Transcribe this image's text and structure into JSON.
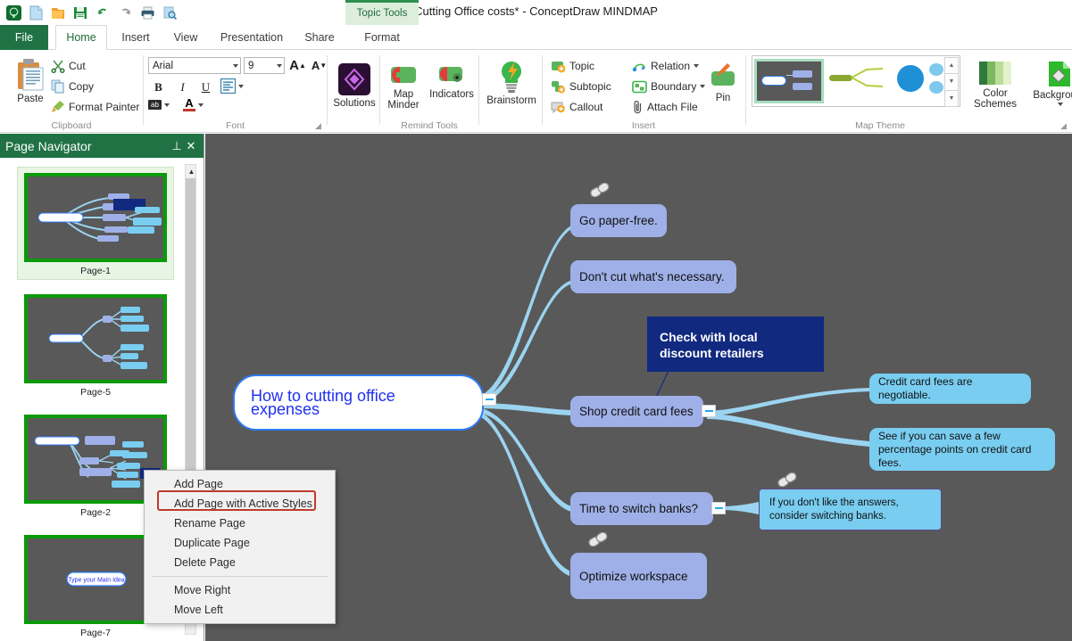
{
  "window": {
    "title": "Cutting Office costs* - ConceptDraw MINDMAP",
    "contextual_tools": "Topic Tools",
    "contextual_tab": "Format"
  },
  "quick_access": [
    {
      "name": "app-logo-icon",
      "glyph": "CD"
    },
    {
      "name": "new-document-icon",
      "glyph": "new"
    },
    {
      "name": "open-folder-icon",
      "glyph": "open"
    },
    {
      "name": "save-icon",
      "glyph": "save"
    },
    {
      "name": "undo-icon",
      "glyph": "undo"
    },
    {
      "name": "redo-icon",
      "glyph": "redo"
    },
    {
      "name": "print-icon",
      "glyph": "print"
    },
    {
      "name": "print-preview-icon",
      "glyph": "preview"
    }
  ],
  "tabs": [
    {
      "label": "File",
      "active": false
    },
    {
      "label": "Home",
      "active": true
    },
    {
      "label": "Insert",
      "active": false
    },
    {
      "label": "View",
      "active": false
    },
    {
      "label": "Presentation",
      "active": false
    },
    {
      "label": "Share",
      "active": false
    },
    {
      "label": "Format",
      "active": false
    }
  ],
  "ribbon": {
    "clipboard": {
      "title": "Clipboard",
      "paste": "Paste",
      "cut": "Cut",
      "copy": "Copy",
      "format_painter": "Format Painter"
    },
    "font": {
      "title": "Font",
      "family": "Arial",
      "size": "9",
      "grow_label": "A",
      "shrink_label": "A",
      "bold": "B",
      "italic": "I",
      "underline": "U",
      "highlight": "ab",
      "font_color": "A"
    },
    "solutions": {
      "label": "Solutions"
    },
    "remind_tools": {
      "title": "Remind Tools",
      "map_minder": "Map Minder",
      "indicators": "Indicators"
    },
    "brainstorm": {
      "label": "Brainstorm"
    },
    "insert": {
      "title": "Insert",
      "topic": "Topic",
      "subtopic": "Subtopic",
      "callout": "Callout",
      "relation": "Relation",
      "boundary": "Boundary",
      "attach_file": "Attach File",
      "pin": "Pin"
    },
    "map_theme": {
      "title": "Map Theme",
      "color_schemes": "Color Schemes",
      "background": "Background",
      "themes": [
        {
          "name": "theme-dark-selected",
          "selected": true
        },
        {
          "name": "theme-olive",
          "selected": false
        },
        {
          "name": "theme-blue-circle",
          "selected": false
        }
      ]
    }
  },
  "page_navigator": {
    "title": "Page Navigator",
    "pin_icon": "pin-icon",
    "close_icon": "close-icon",
    "pages": [
      {
        "label": "Page-1",
        "selected": true
      },
      {
        "label": "Page-5",
        "selected": false
      },
      {
        "label": "Page-2",
        "selected": false
      },
      {
        "label": "Page-7",
        "selected": false
      }
    ],
    "page7_placeholder": "Type your Main Idea"
  },
  "context_menu": {
    "items": [
      {
        "label": "Add Page",
        "highlighted": false,
        "separator_after": false
      },
      {
        "label": "Add Page with Active Styles",
        "highlighted": true,
        "separator_after": false
      },
      {
        "label": "Rename Page",
        "highlighted": false,
        "separator_after": false
      },
      {
        "label": "Duplicate Page",
        "highlighted": false,
        "separator_after": false
      },
      {
        "label": "Delete Page",
        "highlighted": false,
        "separator_after": true
      },
      {
        "label": "Move Right",
        "highlighted": false,
        "separator_after": false
      },
      {
        "label": "Move Left",
        "highlighted": false,
        "separator_after": false
      }
    ],
    "highlight_color": "#c0392b"
  },
  "mindmap": {
    "central_topic": "How to cutting office expenses",
    "nodes": [
      {
        "id": "go-paper-free",
        "text": "Go paper-free.",
        "type": "main",
        "has_link_icon": true
      },
      {
        "id": "dont-cut",
        "text": "Don't cut what's necessary.",
        "type": "main",
        "has_link_icon": false
      },
      {
        "id": "shop-credit-card-fees",
        "text": "Shop credit card fees",
        "type": "main",
        "has_link_icon": false,
        "collapsible": true
      },
      {
        "id": "time-to-switch-banks",
        "text": "Time to switch banks?",
        "type": "main",
        "has_link_icon": false,
        "collapsible": true
      },
      {
        "id": "optimize-workspace",
        "text": "Optimize workspace",
        "type": "main",
        "has_link_icon": true
      },
      {
        "id": "check-local-retailers",
        "text": "Check with local discount retailers",
        "type": "navy",
        "has_link_icon": false
      },
      {
        "id": "credit-card-negotiable",
        "text": "Credit card fees are negotiable.",
        "type": "sub",
        "has_link_icon": false
      },
      {
        "id": "save-percentage-points",
        "text": "See if you can save a few percentage points on credit card fees.",
        "type": "sub",
        "has_link_icon": false
      },
      {
        "id": "switching-banks-callout",
        "text": "If you don't like the answers, consider switching banks.",
        "type": "callout",
        "has_link_icon": true
      }
    ],
    "colors": {
      "canvas_background": "#595959",
      "main_topic_fill": "#9fb0e8",
      "sub_topic_fill": "#79cdf0",
      "navy_fill": "#11297f",
      "central_border": "#2f7bf6",
      "central_text": "#2030f0",
      "connector": "#9bd4f0"
    }
  }
}
